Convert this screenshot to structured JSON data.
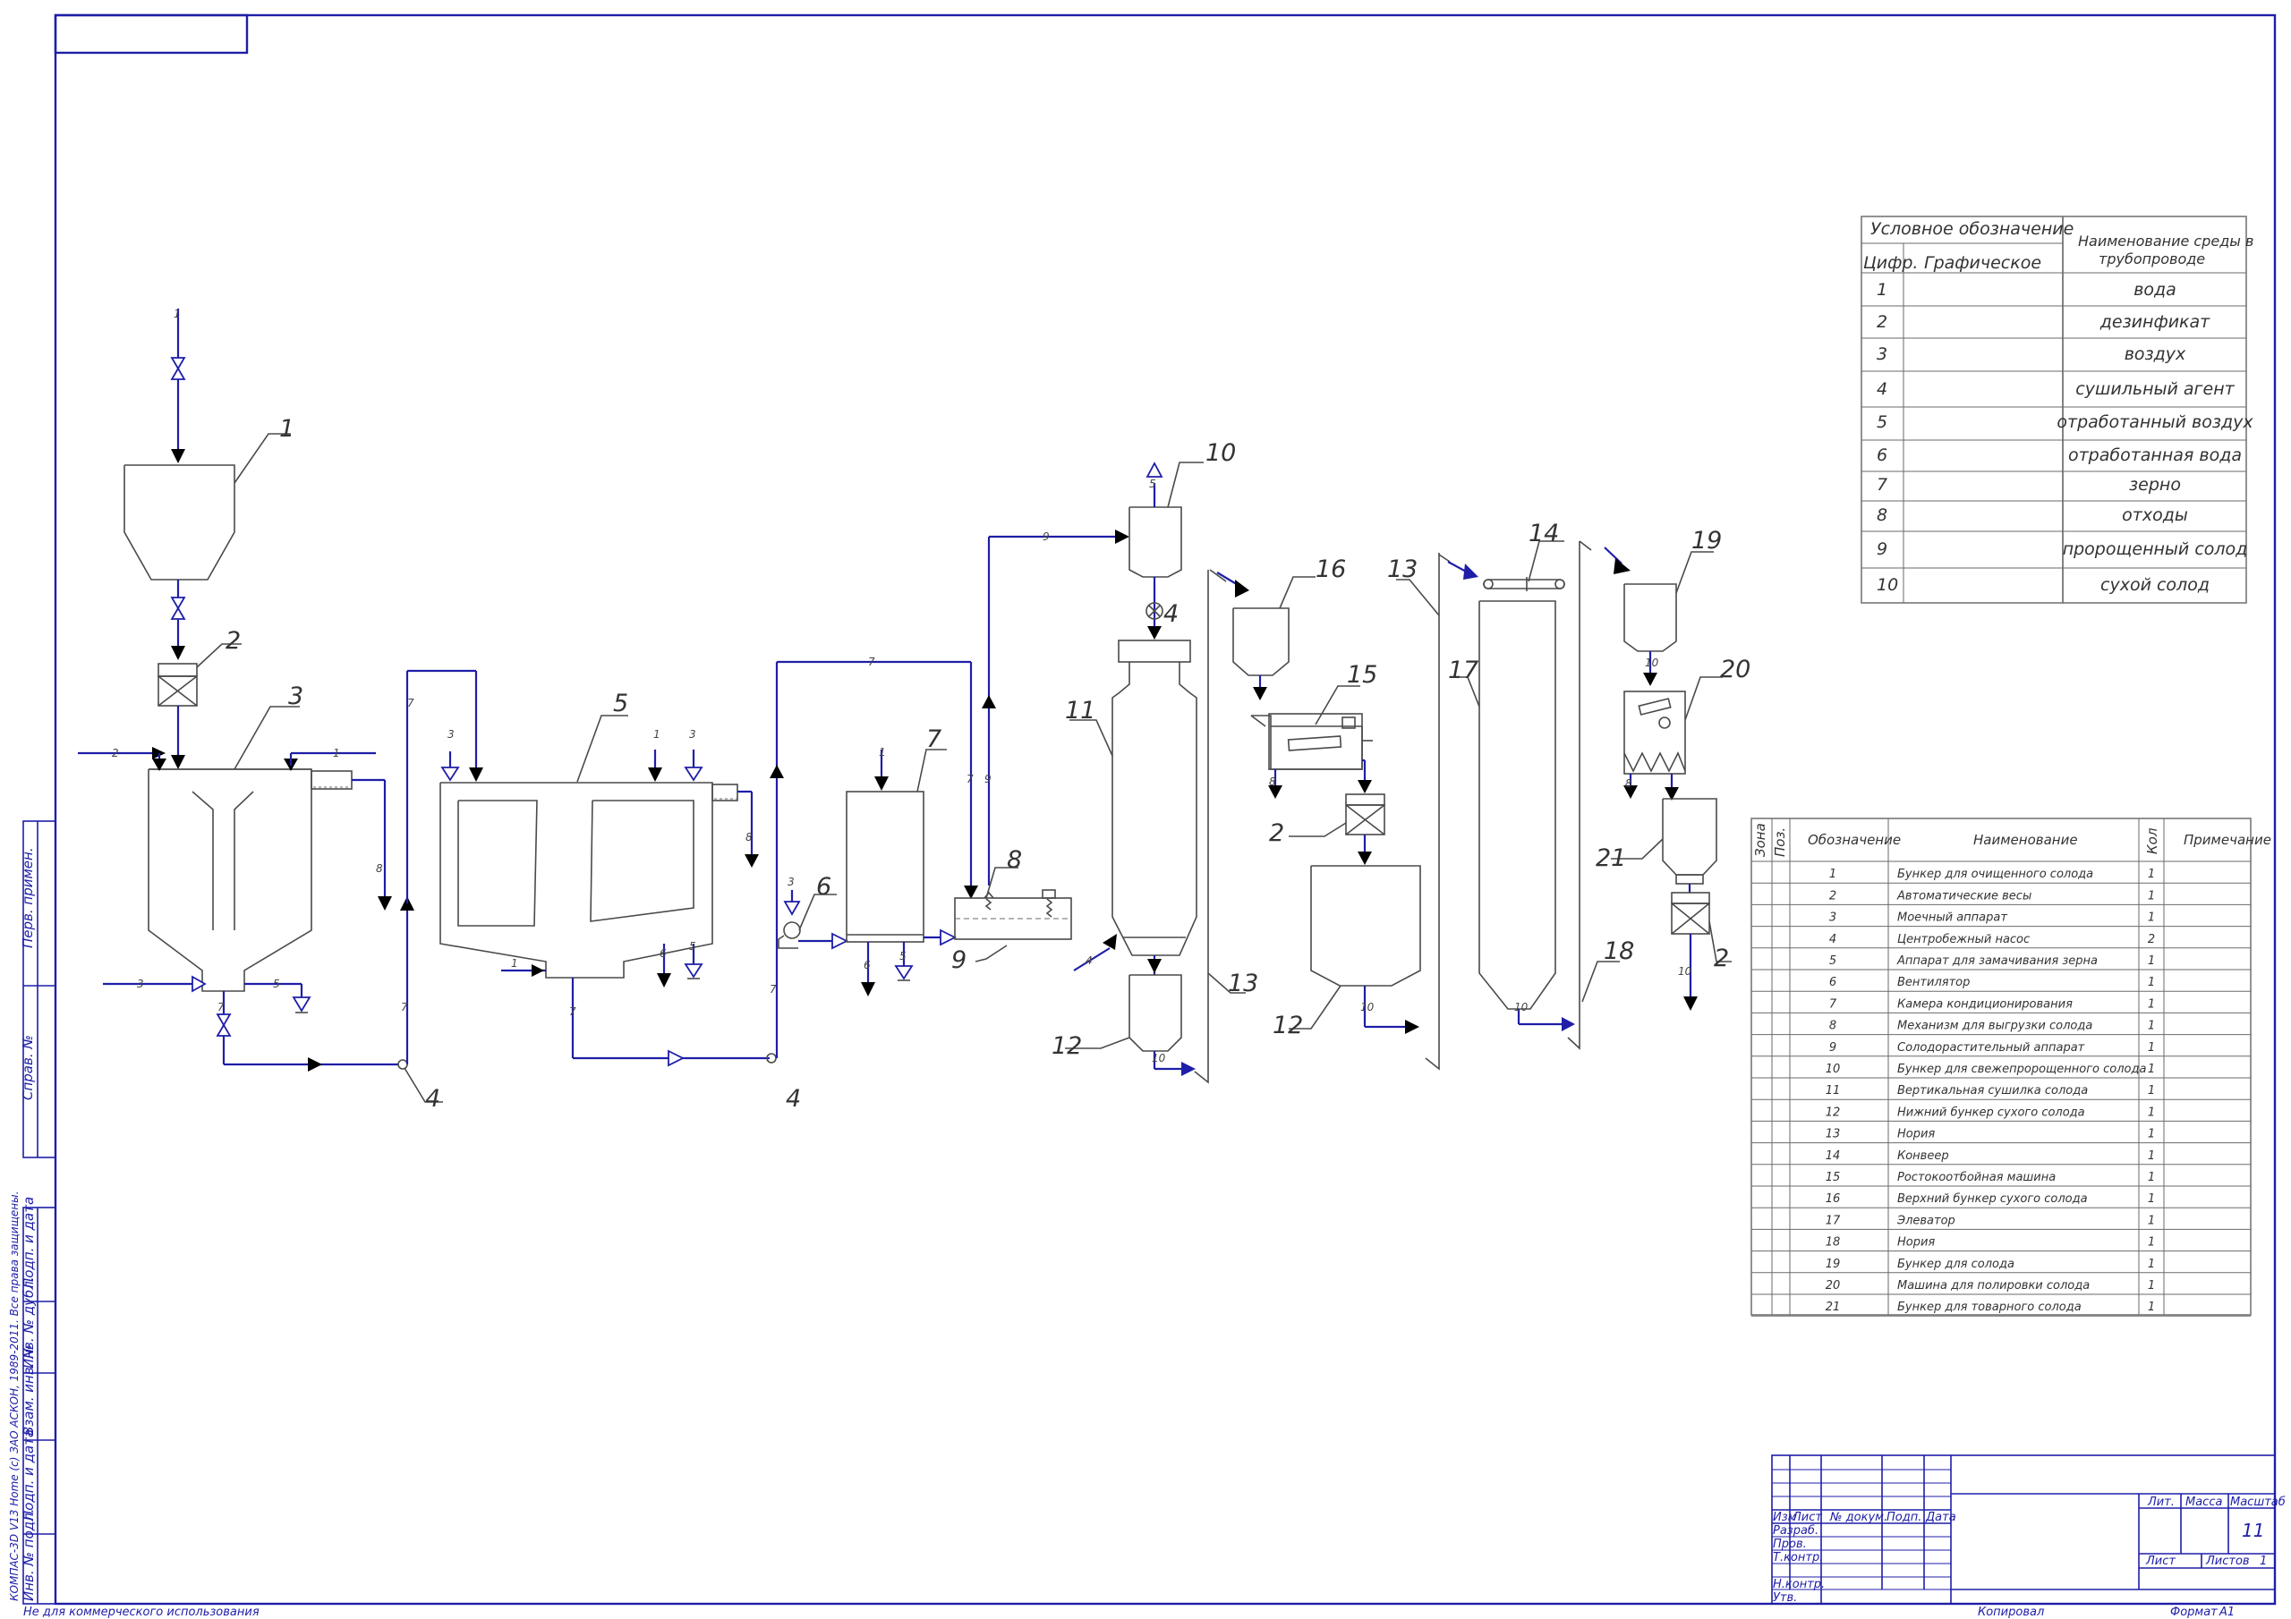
{
  "labels": [
    "1",
    "2",
    "3",
    "4",
    "5",
    "6",
    "7",
    "8",
    "9",
    "10",
    "11",
    "12",
    "13",
    "14",
    "15",
    "16",
    "17",
    "18",
    "19",
    "20",
    "21"
  ],
  "legend": {
    "header_symbol": "Условное обозначение",
    "header_digit": "Цифр.",
    "header_graphic": "Графическое",
    "header_medium": "Наименование среды в трубопроводе",
    "rows": [
      {
        "n": "1",
        "name": "вода"
      },
      {
        "n": "2",
        "name": "дезинфикат"
      },
      {
        "n": "3",
        "name": "воздух"
      },
      {
        "n": "4",
        "name": "сушильный агент"
      },
      {
        "n": "5",
        "name": "отработанный воздух"
      },
      {
        "n": "6",
        "name": "отработанная вода"
      },
      {
        "n": "7",
        "name": "зерно"
      },
      {
        "n": "8",
        "name": "отходы"
      },
      {
        "n": "9",
        "name": "пророщенный солод"
      },
      {
        "n": "10",
        "name": "сухой солод"
      }
    ]
  },
  "spec": {
    "headers": {
      "zone": "Зона",
      "pos": "Поз.",
      "designation": "Обозначение",
      "name": "Наименование",
      "qty": "Кол",
      "note": "Примечание"
    },
    "rows": [
      {
        "n": "1",
        "name": "Бункер для очищенного солода",
        "q": "1"
      },
      {
        "n": "2",
        "name": "Автоматические весы",
        "q": "1"
      },
      {
        "n": "3",
        "name": "Моечный аппарат",
        "q": "1"
      },
      {
        "n": "4",
        "name": "Центробежный насос",
        "q": "2"
      },
      {
        "n": "5",
        "name": "Аппарат для замачивания зерна",
        "q": "1"
      },
      {
        "n": "6",
        "name": "Вентилятор",
        "q": "1"
      },
      {
        "n": "7",
        "name": "Камера кондиционирования",
        "q": "1"
      },
      {
        "n": "8",
        "name": "Механизм для выгрузки солода",
        "q": "1"
      },
      {
        "n": "9",
        "name": "Солодорастительный аппарат",
        "q": "1"
      },
      {
        "n": "10",
        "name": "Бункер для свежепророщенного солода",
        "q": "1"
      },
      {
        "n": "11",
        "name": "Вертикальная сушилка солода",
        "q": "1"
      },
      {
        "n": "12",
        "name": "Нижний бункер сухого солода",
        "q": "1"
      },
      {
        "n": "13",
        "name": "Нория",
        "q": "1"
      },
      {
        "n": "14",
        "name": "Конвеер",
        "q": "1"
      },
      {
        "n": "15",
        "name": "Ростокоотбойная машина",
        "q": "1"
      },
      {
        "n": "16",
        "name": "Верхний бункер сухого солода",
        "q": "1"
      },
      {
        "n": "17",
        "name": "Элеватор",
        "q": "1"
      },
      {
        "n": "18",
        "name": "Нория",
        "q": "1"
      },
      {
        "n": "19",
        "name": "Бункер для солода",
        "q": "1"
      },
      {
        "n": "20",
        "name": "Машина для полировки солода",
        "q": "1"
      },
      {
        "n": "21",
        "name": "Бункер для товарного солода",
        "q": "1"
      }
    ]
  },
  "stamp": {
    "change": "Изм",
    "sheet": "Лист",
    "docnum": "№ докум.",
    "sign": "Подп.",
    "date": "Дата",
    "developed": "Разраб.",
    "checked": "Пров.",
    "tcontrol": "Т.контр.",
    "ncontrol": "Н.контр.",
    "approved": "Утв.",
    "lit": "Лит.",
    "mass": "Масса",
    "scale": "Масштаб",
    "scale_value": "11",
    "sheet2": "Лист",
    "sheets": "Листов",
    "sheets_value": "1",
    "copied": "Копировал",
    "format": "Формат",
    "format_value": "A1"
  },
  "side_strip": {
    "perv": "Перв. примен.",
    "sprav": "Справ. №",
    "podp_data": "Подп. и дата",
    "inv_dubl": "Инв. № дубл.",
    "vzam": "Взам. инв. №",
    "podp_data2": "Подп. и дата",
    "inv_podl": "Инв. № подл."
  },
  "footer": {
    "noncommercial": "Не для коммерческого использования",
    "kompas": "КОМПАС-3D V13 Home (с) ЗАО АСКОН, 1989-2011. Все права защищены."
  }
}
